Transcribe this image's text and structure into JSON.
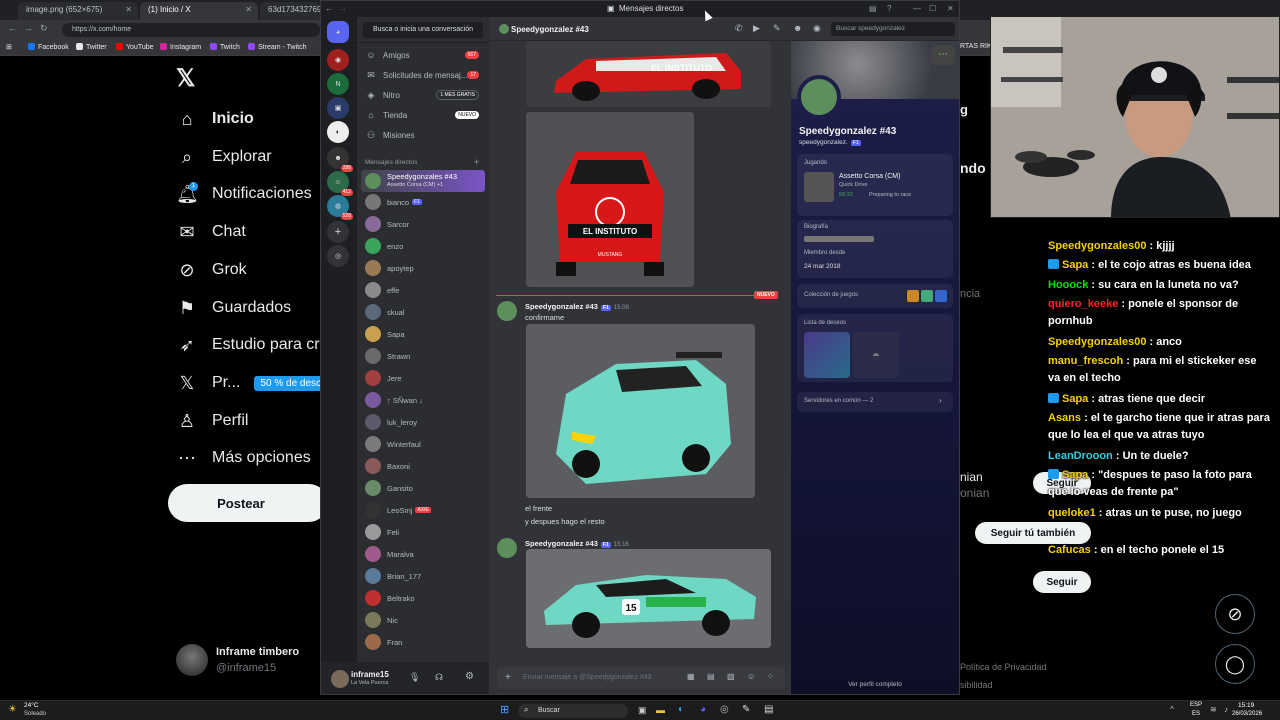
{
  "browser": {
    "tabs": [
      {
        "label": "image.png (652×675)"
      },
      {
        "label": "(1) Inicio / X"
      },
      {
        "label": "63d1734327694c"
      }
    ],
    "url": "https://x.com/home",
    "bookmarks": [
      "Facebook",
      "Twitter",
      "YouTube",
      "Instagram",
      "Twitch",
      "Stream - Twitch"
    ],
    "bookmark_trailing": "RTAS RIKY S"
  },
  "x": {
    "nav": [
      {
        "label": "Inicio",
        "icon": "home-icon"
      },
      {
        "label": "Explorar",
        "icon": "search-icon"
      },
      {
        "label": "Notificaciones",
        "icon": "bell-icon"
      },
      {
        "label": "Chat",
        "icon": "mail-icon"
      },
      {
        "label": "Grok",
        "icon": "grok-icon"
      },
      {
        "label": "Guardados",
        "icon": "bookmark-icon"
      },
      {
        "label": "Estudio para cre",
        "icon": "rocket-icon"
      },
      {
        "label": "Pr...",
        "icon": "x-premium-icon"
      },
      {
        "label": "Perfil",
        "icon": "person-icon"
      },
      {
        "label": "Más opciones",
        "icon": "more-icon"
      }
    ],
    "notif_count": "1",
    "premium_badge": "50 % de desc",
    "post_label": "Postear",
    "user_name": "Inframe timbero",
    "user_handle": "@inframe15",
    "right_snippets": {
      "g": "g",
      "ndo": "ndo",
      "ncia": "ncia",
      "nian1": "nian",
      "nian2": "onian",
      "privacy": "Política de Privacidad",
      "acc": "sibilidad"
    },
    "follow_label": "Seguir",
    "follow_too_label": "Seguir tú también"
  },
  "chat_overlay": [
    {
      "user": "Speedygonzales00",
      "color": "#f5d000",
      "text": ": kjjjj",
      "twitch": false
    },
    {
      "user": "Sapa",
      "color": "#f5d000",
      "text": ": el te cojo atras es buena idea",
      "twitch": true
    },
    {
      "user": "Hooock",
      "color": "#00e000",
      "text": ": su cara en la luneta no va?",
      "twitch": false
    },
    {
      "user": "quiero_keeke",
      "color": "#ff2020",
      "text": ": ponele el sponsor de pornhub",
      "twitch": false
    },
    {
      "user": "Speedygonzales00",
      "color": "#f5d000",
      "text": ": anco",
      "twitch": false
    },
    {
      "user": "manu_frescoh",
      "color": "#f5d000",
      "text": ": para mi el stickeker ese va en el techo",
      "twitch": false
    },
    {
      "user": "Sapa",
      "color": "#f5d000",
      "text": ": atras tiene que decir",
      "twitch": true
    },
    {
      "user": "Asans",
      "color": "#f5d000",
      "text": ": el te garcho tiene que ir atras para que lo lea el que va atras tuyo",
      "twitch": false
    },
    {
      "user": "LeanDrooon",
      "color": "#2ecfe0",
      "text": ": Un te duele?",
      "twitch": false
    },
    {
      "user": "Sapa",
      "color": "#f5d000",
      "text": ": \"despues te paso la foto para que lo veas de frente pa\"",
      "twitch": true
    },
    {
      "user": "queloke1",
      "color": "#f5d000",
      "text": ": atras un te puse, no juego",
      "twitch": false
    },
    {
      "user": "Cafucas",
      "color": "#f5d000",
      "text": ": en el techo ponele el 15",
      "twitch": false
    }
  ],
  "discord": {
    "title": "Mensajes directos",
    "search_conversation": "Busca o inicia una conversación",
    "nav": [
      {
        "label": "Amigos",
        "badge": "567",
        "icon": "friends-icon"
      },
      {
        "label": "Solicitudes de mensaj...",
        "badge": "17",
        "icon": "inbox-icon"
      },
      {
        "label": "Nitro",
        "badge": "1 MES GRATIS",
        "icon": "nitro-icon"
      },
      {
        "label": "Tienda",
        "badge": "NUEVO",
        "icon": "shop-icon"
      },
      {
        "label": "Misiones",
        "badge": "",
        "icon": "quests-icon"
      }
    ],
    "dm_header": "Mensajes directos",
    "dms": [
      {
        "name": "Speedygonzales #43",
        "sub": "Assetto Corsa (CM) +1",
        "color": "#5c8f5c",
        "tag": "F1"
      },
      {
        "name": "bianco",
        "sub": "",
        "color": "#777",
        "tag": "F1"
      },
      {
        "name": "Sarcor",
        "sub": "",
        "color": "#8a6a9a",
        "tag": ""
      },
      {
        "name": "enzo",
        "sub": "",
        "color": "#3ba55c",
        "tag": ""
      },
      {
        "name": "apoytep",
        "sub": "",
        "color": "#9a7a55",
        "tag": ""
      },
      {
        "name": "effe",
        "sub": "",
        "color": "#8a8a8a",
        "tag": ""
      },
      {
        "name": "skual",
        "sub": "",
        "color": "#5a6a7a",
        "tag": ""
      },
      {
        "name": "Sapa",
        "sub": "",
        "color": "#c8a050",
        "tag": ""
      },
      {
        "name": "Strawn",
        "sub": "",
        "color": "#6a6a6a",
        "tag": ""
      },
      {
        "name": "Jere",
        "sub": "",
        "color": "#a04040",
        "tag": ""
      },
      {
        "name": "↑ SÑwan ↓",
        "sub": "",
        "color": "#7a5aa0",
        "tag": ""
      },
      {
        "name": "luk_leroy",
        "sub": "",
        "color": "#5a5a6a",
        "tag": ""
      },
      {
        "name": "Winterfaul",
        "sub": "",
        "color": "#7a7a7a",
        "tag": ""
      },
      {
        "name": "Baxoni",
        "sub": "",
        "color": "#8a5a5a",
        "tag": ""
      },
      {
        "name": "Gansito",
        "sub": "",
        "color": "#6a8a6a",
        "tag": ""
      },
      {
        "name": "LeoSmj",
        "sub": "",
        "color": "#333",
        "tag": "AXIE"
      },
      {
        "name": "Feli",
        "sub": "",
        "color": "#9a9a9a",
        "tag": ""
      },
      {
        "name": "Maralva",
        "sub": "",
        "color": "#a05a8a",
        "tag": ""
      },
      {
        "name": "Brian_177",
        "sub": "",
        "color": "#5a7a9a",
        "tag": ""
      },
      {
        "name": "Beltrako",
        "sub": "",
        "color": "#c03030",
        "tag": ""
      },
      {
        "name": "Nic",
        "sub": "",
        "color": "#7a7a5a",
        "tag": ""
      },
      {
        "name": "Fran",
        "sub": "",
        "color": "#9a6a4a",
        "tag": ""
      }
    ],
    "self_name": "inframe15",
    "self_status": "La Vela Puerca",
    "chat_header": "Speedygonzalez #43",
    "search_placeholder": "Buscar speedygonzalez",
    "new_label": "NUEVO",
    "messages": [
      {
        "author": "Speedygonzalez #43",
        "tag": "F1",
        "time": "15:08",
        "lines": [
          "confirmame"
        ]
      },
      {
        "author": "Speedygonzalez #43",
        "tag": "F1",
        "time": "15:16",
        "lines": []
      }
    ],
    "caption_lines": [
      "el frente",
      "y despues hago el resto"
    ],
    "composer_placeholder": "Enviar mensaje a @Speedygonzalez #43",
    "profile": {
      "name": "Speedygonzalez #43",
      "handle": "speedygonzalez.",
      "tag": "F1",
      "playing_label": "Jugando",
      "game": "Assetto Corsa (CM)",
      "game_mode": "Quick Drive",
      "game_time": "58:32",
      "game_state": "Preparing to race",
      "bio_label": "Biografía",
      "member_since_label": "Miembro desde",
      "member_since": "24 mar 2018",
      "collection_label": "Colección de juegos",
      "wishlist_label": "Lista de deseos",
      "servers_label": "Servidores en común — 2",
      "view_full": "Ver perfil completo"
    },
    "guild_badges": [
      "286",
      "412",
      "528"
    ]
  },
  "car_labels": {
    "red_sign": "EL INSTITUTO",
    "red_model": "MUSTANG",
    "teal_number": "15"
  },
  "taskbar": {
    "weather_temp": "24°C",
    "weather_text": "Soleado",
    "search": "Buscar",
    "lang1": "ESP",
    "lang2": "ES",
    "time": "15:19",
    "date": "26/03/2026"
  },
  "colors": {
    "twitter_blue": "#1d9bf0",
    "discord_blurple": "#5865f2",
    "discord_red": "#f23f43"
  }
}
